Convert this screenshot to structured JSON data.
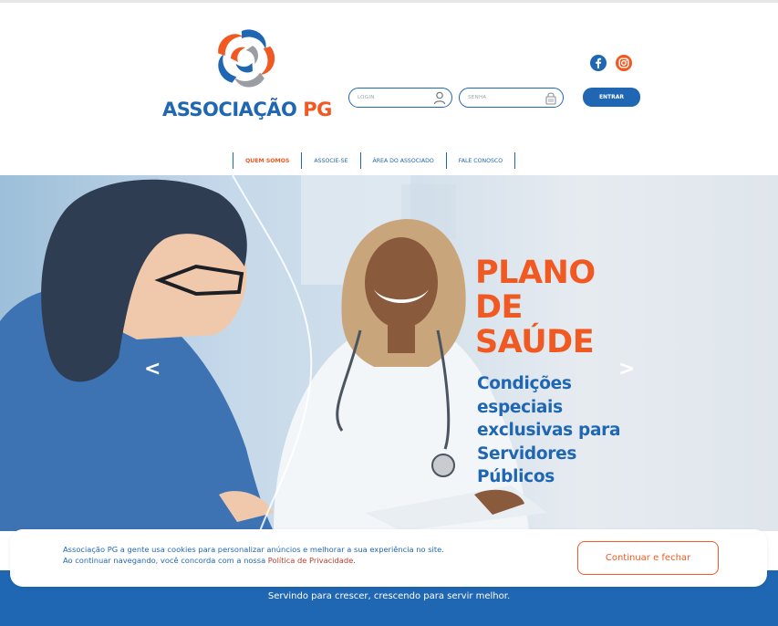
{
  "brand": {
    "name_part1": "ASSOCIAÇÃO",
    "name_part2": "PG",
    "primary_color": "#1f66b3",
    "accent_color": "#f05a22"
  },
  "header": {
    "social": [
      {
        "icon": "facebook-icon"
      },
      {
        "icon": "instagram-icon"
      }
    ],
    "login_placeholder": "LOGIN",
    "senha_placeholder": "SENHA",
    "entrar_label": "ENTRAR"
  },
  "nav": {
    "items": [
      {
        "label": "QUEM SOMOS",
        "active": true
      },
      {
        "label": "ASSOCIE-SE",
        "active": false
      },
      {
        "label": "ÁREA DO ASSOCIADO",
        "active": false
      },
      {
        "label": "FALE CONOSCO",
        "active": false
      }
    ]
  },
  "hero": {
    "title_lines": [
      "PLANO",
      "DE",
      "SAÚDE"
    ],
    "subtitle_lines": [
      "Condições",
      "especiais",
      "exclusivas para",
      "Servidores",
      "Públicos"
    ],
    "prev_arrow": "<",
    "next_arrow": ">"
  },
  "cookie": {
    "line1": "Associação PG a gente usa cookies para personalizar anúncios e melhorar a sua experiência no site.",
    "line2_prefix": "Ao continuar navegando, você concorda com a nossa ",
    "policy_link": "Política de Privacidade",
    "line2_suffix": ".",
    "button_label": "Continuar e fechar"
  },
  "footer": {
    "tagline": "Servindo para crescer, crescendo para servir melhor."
  }
}
